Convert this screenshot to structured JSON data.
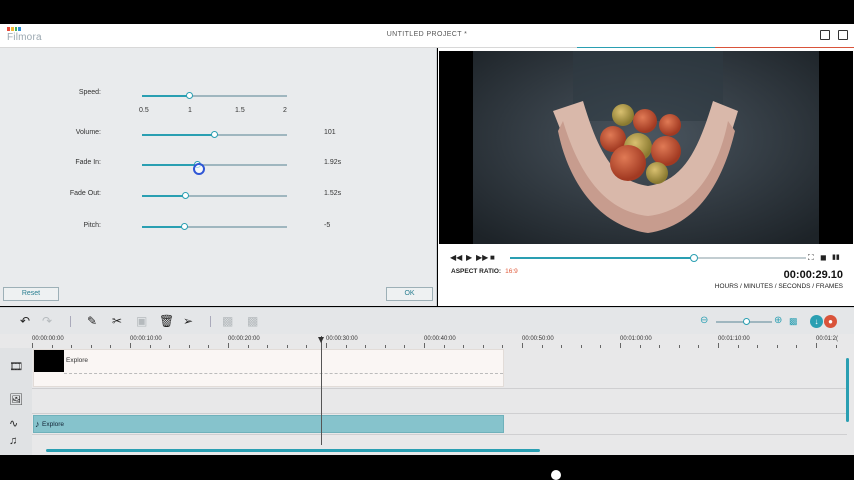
{
  "app": {
    "logo_text": "Filmora",
    "project_title": "UNTITLED PROJECT *",
    "logo_colors": [
      "#e94b3c",
      "#f2b632",
      "#3fae5b",
      "#2f8fd6"
    ]
  },
  "accent": "#2a9fb2",
  "strip_colors": [
    "#2a9fb2",
    "#d9533a"
  ],
  "audio_panel": {
    "speed": {
      "label": "Speed:",
      "level": 0.33,
      "ticks": [
        "0.5",
        "1",
        "1.5",
        "2"
      ]
    },
    "volume": {
      "label": "Volume:",
      "level": 0.5,
      "value": "101"
    },
    "fade_in": {
      "label": "Fade In:",
      "level": 0.38,
      "value": "1.92s"
    },
    "fade_out": {
      "label": "Fade Out:",
      "level": 0.3,
      "value": "1.52s"
    },
    "pitch": {
      "label": "Pitch:",
      "level": 0.29,
      "value": "-5"
    },
    "reset_label": "Reset",
    "ok_label": "OK"
  },
  "preview": {
    "aspect_label": "ASPECT RATIO:",
    "aspect_value": "16:9",
    "timecode": "00:00:29.10",
    "timecode_label": "HOURS / MINUTES / SECONDS / FRAMES",
    "playback_progress": 0.62
  },
  "timeline": {
    "ruler": [
      "00:00:00:00",
      "00:00:10:00",
      "00:00:20:00",
      "00:00:30:00",
      "00:00:40:00",
      "00:00:50:00",
      "00:01:00:00",
      "00:01:10:00",
      "00:01:2("
    ],
    "video_clip_name": "Explore",
    "audio_clip_name": "Explore"
  }
}
